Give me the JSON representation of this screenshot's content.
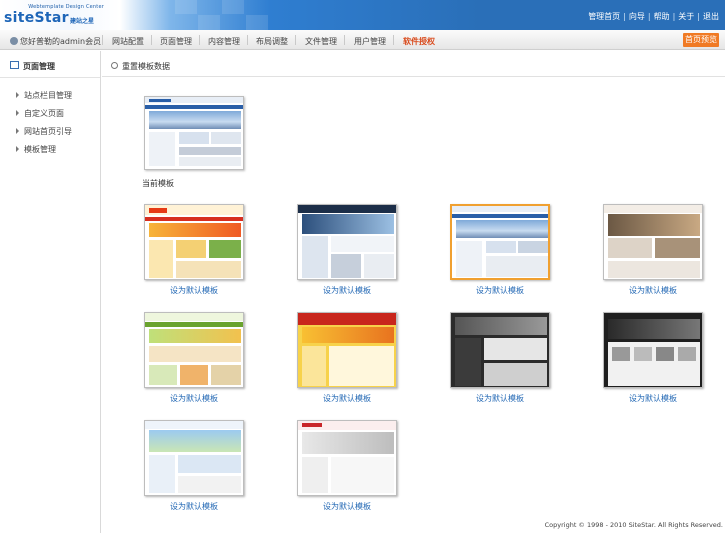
{
  "header": {
    "logo_sub": "Webtemplate Design Center",
    "logo_brand": "siteStar",
    "logo_cn": "建站之星",
    "links": [
      "管理首页",
      "向导",
      "帮助",
      "关于",
      "退出"
    ]
  },
  "nav": {
    "user": "您好普勒的admin会员",
    "items": [
      "网站配置",
      "页面管理",
      "内容管理",
      "布局调整",
      "文件管理",
      "用户管理",
      "软件授权"
    ],
    "preview": "首页预览"
  },
  "sidebar": {
    "title": "页面管理",
    "items": [
      "站点栏目管理",
      "自定义页面",
      "网站首页引导",
      "模板管理"
    ]
  },
  "main": {
    "title": "重置模板数据",
    "current_label": "当前模板",
    "set_default": "设为默认模板",
    "templates": [
      {
        "name": "template-1"
      },
      {
        "name": "template-2"
      },
      {
        "name": "template-3",
        "selected": true
      },
      {
        "name": "template-4"
      },
      {
        "name": "template-5"
      },
      {
        "name": "template-6"
      },
      {
        "name": "template-7"
      },
      {
        "name": "template-8"
      },
      {
        "name": "template-9"
      },
      {
        "name": "template-10"
      }
    ]
  },
  "footer": "Copyright © 1998 - 2010 SiteStar. All Rights Reserved.",
  "colors": {
    "accent": "#f07a24",
    "link": "#2469b5",
    "header_blue": "#2a6fb8",
    "special_nav": "#d94a1c"
  }
}
